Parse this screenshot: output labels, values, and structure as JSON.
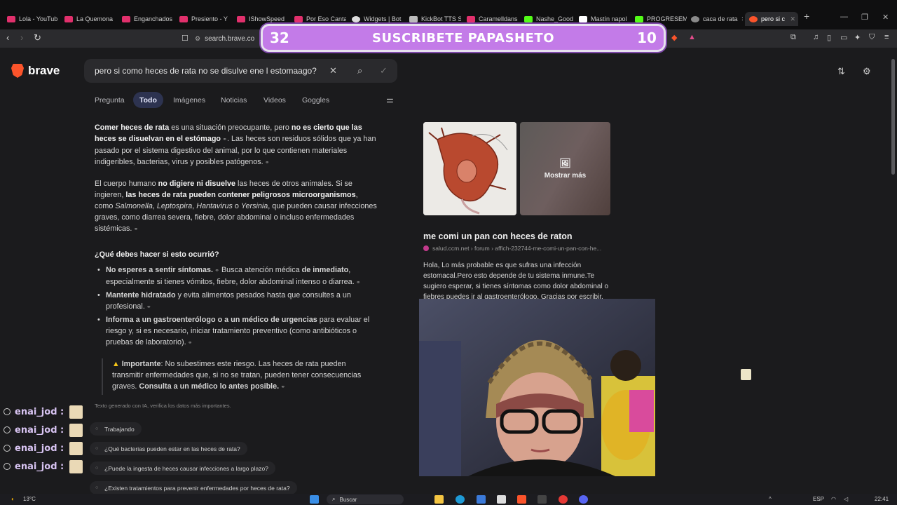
{
  "browser": {
    "tabs": [
      {
        "label": "Lola - YouTub",
        "color": "#e1306c"
      },
      {
        "label": "La Quemona",
        "color": "#e1306c"
      },
      {
        "label": "Enganchados",
        "color": "#e1306c"
      },
      {
        "label": "Presiento - Y",
        "color": "#e1306c"
      },
      {
        "label": "IShowSpeed",
        "color": "#e1306c"
      },
      {
        "label": "Por Eso Canta",
        "color": "#e1306c"
      },
      {
        "label": "Widgets | Bot",
        "color": "#dddddd"
      },
      {
        "label": "KickBot TTS S",
        "color": "#cccccc"
      },
      {
        "label": "Caramelldans",
        "color": "#e1306c"
      },
      {
        "label": "Nashe_Good",
        "color": "#53fc18"
      },
      {
        "label": "Mastín napol",
        "color": "#ffffff"
      },
      {
        "label": "PROGRESEM",
        "color": "#53fc18"
      },
      {
        "label": "caca de rata",
        "color": "#8a8a8a"
      },
      {
        "label": "pero si c",
        "color": "#fb542b"
      }
    ],
    "url": "search.brave.co",
    "new_tab": "+",
    "window_controls": [
      "—",
      "❐",
      "✕"
    ]
  },
  "banner": {
    "left_num": "32",
    "text": "SUSCRIBETE PAPASHETO",
    "right_num": "10"
  },
  "brave": {
    "logo": "brave",
    "query": "pero si como heces de rata  no se disulve ene l estomaago?"
  },
  "search_tabs": [
    "Pregunta",
    "Todo",
    "Imágenes",
    "Noticias",
    "Videos",
    "Goggles"
  ],
  "answer": {
    "p1": {
      "a": "Comer heces de rata",
      "b": " es una situación preocupante, pero ",
      "c": "no es cierto que las heces se disuelvan en el estómago",
      "d": ". Las heces son residuos sólidos que ya han pasado por el sistema digestivo del animal, por lo que contienen materiales indigeribles, bacterias, virus y posibles patógenos."
    },
    "p2": {
      "a": "El cuerpo humano ",
      "b": "no digiere ni disuelve",
      "c": " las heces de otros animales. Si se ingieren, ",
      "d": "las heces de rata pueden contener peligrosos microorganismos",
      "e": ", como ",
      "f": "Salmonella",
      "g": ", ",
      "h": "Leptospira",
      "i": ", ",
      "j": "Hantavirus",
      "k": " o ",
      "l": "Yersinia",
      "m": ", que pueden causar infecciones graves, como diarrea severa, fiebre, dolor abdominal o incluso enfermedades sistémicas."
    },
    "h_question": "¿Qué debes hacer si esto ocurrió?",
    "bullets": [
      {
        "b1": "No esperes a sentir síntomas.",
        "t1": " Busca atención médica ",
        "b2": "de inmediato",
        "t2": ", especialmente si tienes vómitos, fiebre, dolor abdominal intenso o diarrea."
      },
      {
        "b1": "Mantente hidratado",
        "t1": " y evita alimentos pesados hasta que consultes a un profesional.",
        "b2": "",
        "t2": ""
      },
      {
        "b1": "Informa a un gastroenterólogo o a un médico de urgencias",
        "t1": " para evaluar el riesgo y, si es necesario, iniciar tratamiento preventivo (como antibióticos o pruebas de laboratorio).",
        "b2": "",
        "t2": ""
      }
    ],
    "warning": {
      "label": "Importante",
      "text": ": No subestimes este riesgo. Las heces de rata pueden transmitir enfermedades que, si no se tratan, pueden tener consecuencias graves. ",
      "bold_end": "Consulta a un médico lo antes posible."
    },
    "disclaimer": "Texto generado con IA, verifica los datos más importantes.",
    "followups": [
      "Trabajando",
      "¿Qué bacterias pueden estar en las heces de rata?",
      "¿Puede la ingesta de heces causar infecciones a largo plazo?",
      "¿Existen tratamientos para prevenir enfermedades por heces de rata?"
    ]
  },
  "chat": [
    {
      "user": "enai_jod :"
    },
    {
      "user": "enai_jod :"
    },
    {
      "user": "enai_jod :"
    },
    {
      "user": "enai_jod :"
    }
  ],
  "result": {
    "more_images": "Mostrar más",
    "title": "me comi un pan con heces de raton",
    "url": "salud.ccm.net › forum › affich-232744-me-comi-un-pan-con-he...",
    "snippet": "Hola, Lo más probable es que sufras una infección estomacal.Pero esto depende de tu sistema inmune.Te sugiero esperar, si tienes síntomas como dolor abdominal o fiebres puedes ir al gastroenterólogo. Gracias por escribir."
  },
  "taskbar": {
    "weather": "13°C",
    "search": "Buscar",
    "lang": "ESP",
    "time": "22:41"
  },
  "colors": {
    "accent": "#fb542b",
    "banner": "#c37be8",
    "chat_name": "#d8c4f2"
  }
}
